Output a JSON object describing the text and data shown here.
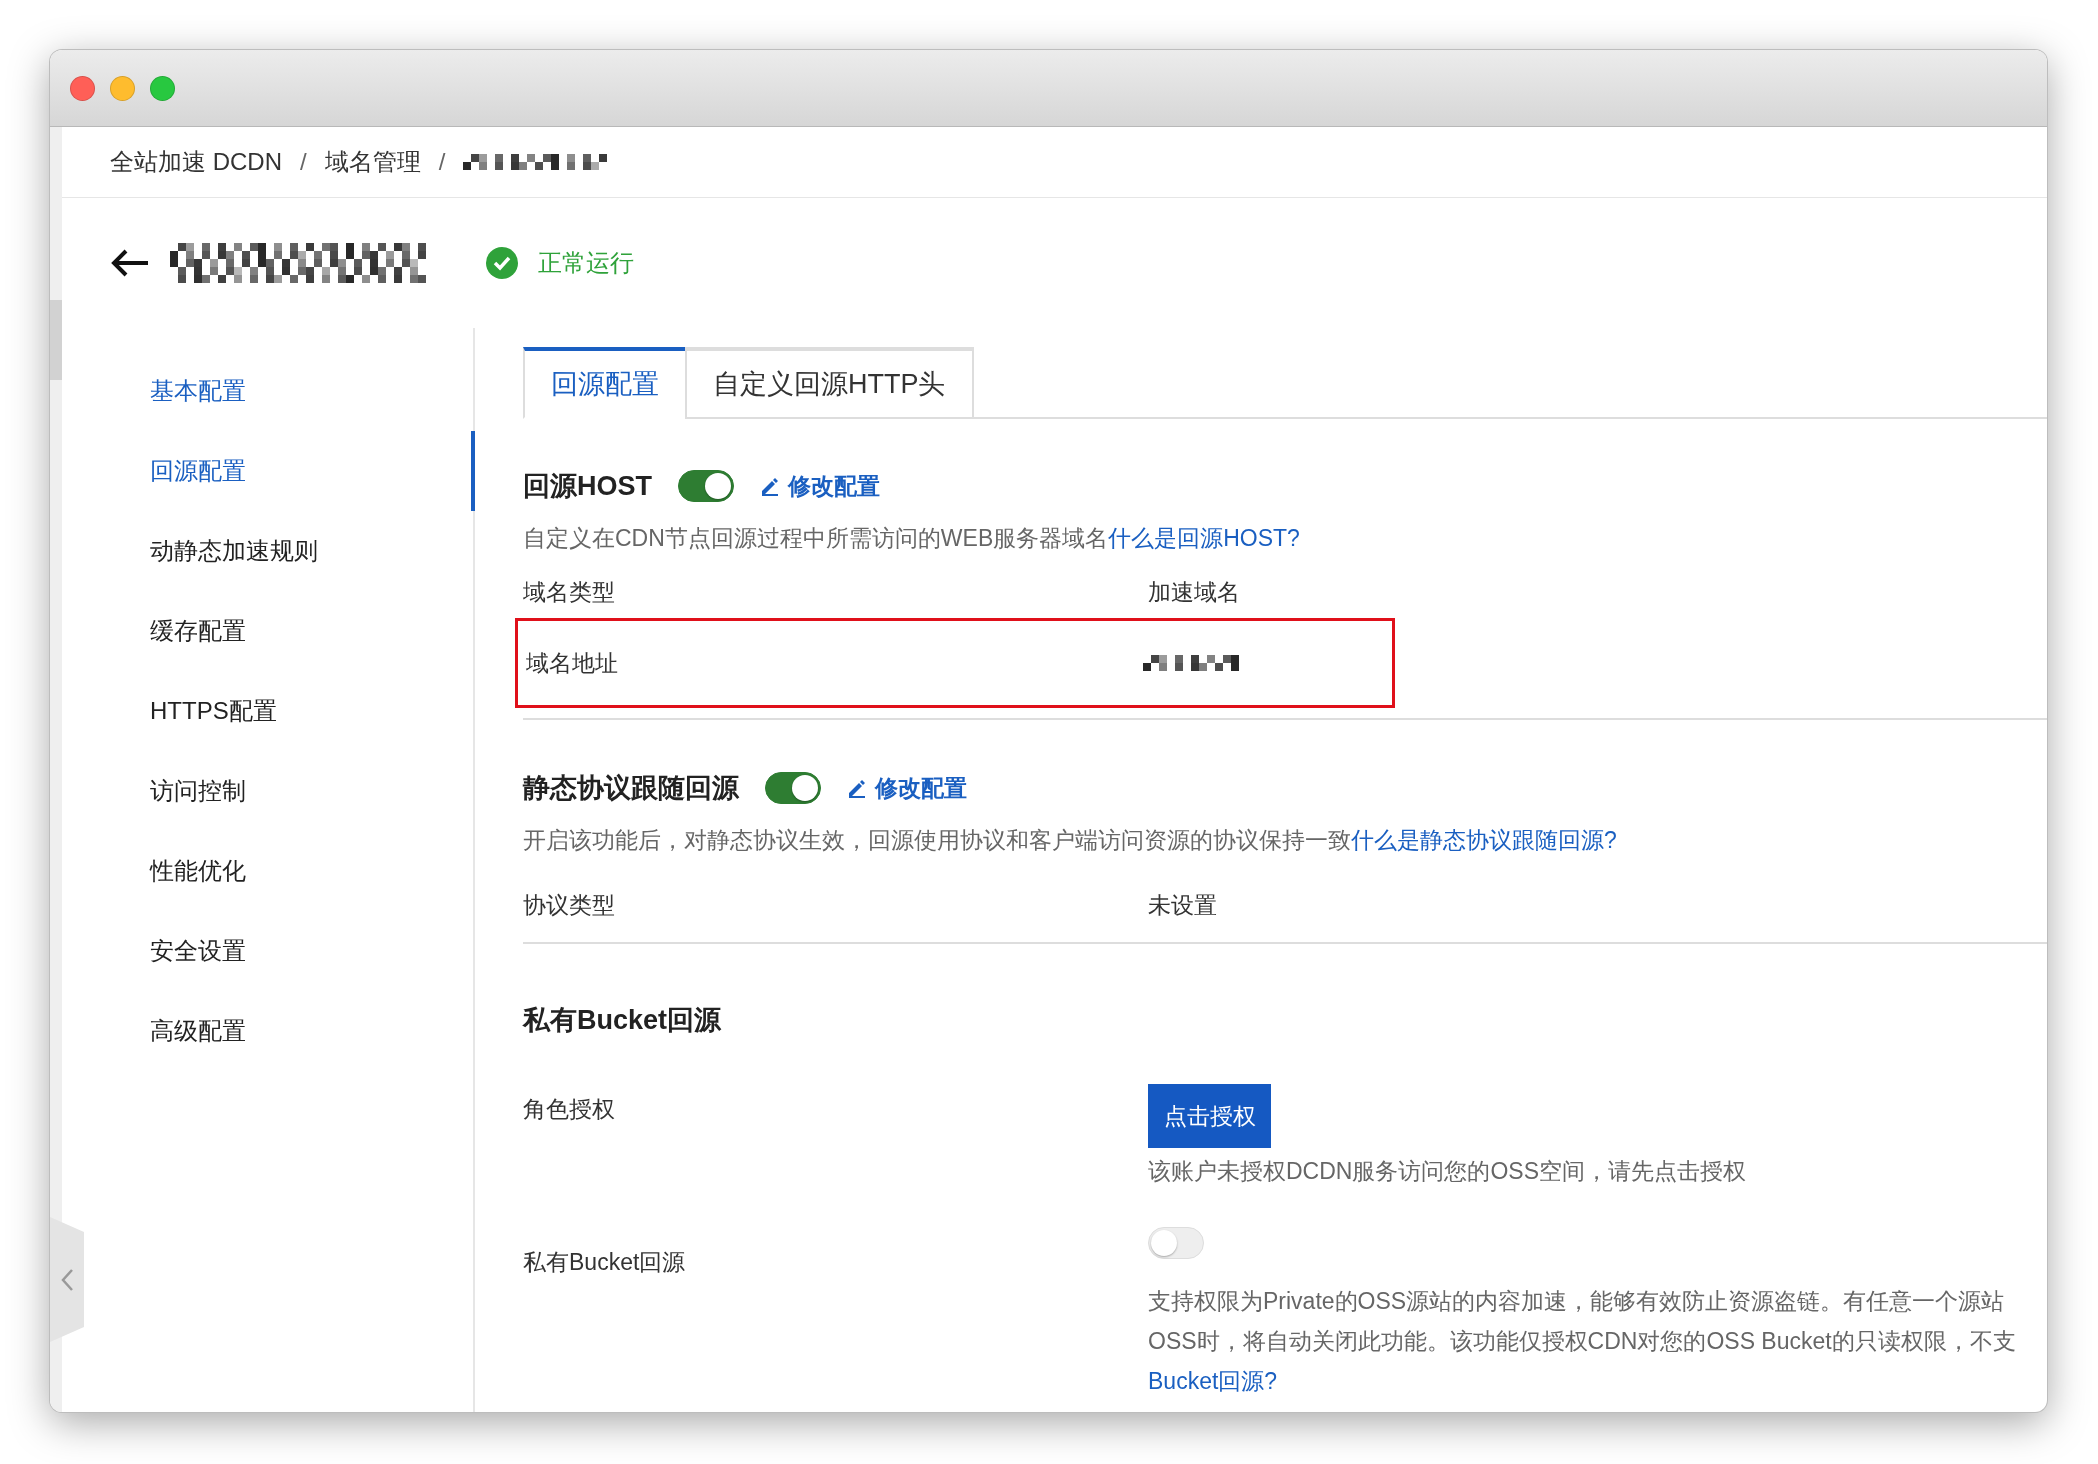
{
  "breadcrumb": [
    {
      "label": "全站加速 DCDN",
      "redacted": false
    },
    {
      "separator": "/",
      "label": "域名管理",
      "redacted": false
    },
    {
      "separator": "/",
      "redacted": true
    }
  ],
  "header": {
    "status": {
      "label": "正常运行",
      "ok": true
    }
  },
  "sidebar": {
    "items": [
      {
        "label": "基本配置",
        "selected": false,
        "highlighted": true
      },
      {
        "label": "回源配置",
        "selected": true,
        "highlighted": true
      },
      {
        "label": "动静态加速规则",
        "selected": false,
        "highlighted": false
      },
      {
        "label": "缓存配置",
        "selected": false,
        "highlighted": false
      },
      {
        "label": "HTTPS配置",
        "selected": false,
        "highlighted": false
      },
      {
        "label": "访问控制",
        "selected": false,
        "highlighted": false
      },
      {
        "label": "性能优化",
        "selected": false,
        "highlighted": false
      },
      {
        "label": "安全设置",
        "selected": false,
        "highlighted": false
      },
      {
        "label": "高级配置",
        "selected": false,
        "highlighted": false
      }
    ]
  },
  "tabs": [
    {
      "label": "回源配置",
      "selected": true
    },
    {
      "label": "自定义回源HTTP头",
      "selected": false
    }
  ],
  "host_section": {
    "title": "回源HOST",
    "on": true,
    "edit_label": "修改配置",
    "description": "自定义在CDN节点回源过程中所需访问的WEB服务器域名",
    "help_link": "什么是回源HOST?",
    "columns": [
      "域名类型",
      "加速域名"
    ],
    "rows": [
      {
        "label": "域名地址",
        "redacted": true,
        "highlighted": true
      }
    ]
  },
  "static_section": {
    "title": "静态协议跟随回源",
    "on": true,
    "edit_label": "修改配置",
    "description": "开启该功能后，对静态协议生效，回源使用协议和客户端访问资源的协议保持一致",
    "help_link": "什么是静态协议跟随回源?",
    "rows": [
      {
        "label": "协议类型",
        "value": "未设置",
        "redacted": false,
        "highlighted": false
      }
    ]
  },
  "bucket_section": {
    "title": "私有Bucket回源",
    "role": {
      "label": "角色授权",
      "button": "点击授权",
      "note": "该账户未授权DCDN服务访问您的OSS空间，请先点击授权"
    },
    "private": {
      "label": "私有Bucket回源",
      "on": false,
      "description_lines": [
        "支持权限为Private的OSS源站的内容加速，能够有效防止资源盗链。有任意一个源站",
        "OSS时，将自动关闭此功能。该功能仅授权CDN对您的OSS Bucket的只读权限，不支"
      ],
      "help_link": "Bucket回源?"
    }
  }
}
